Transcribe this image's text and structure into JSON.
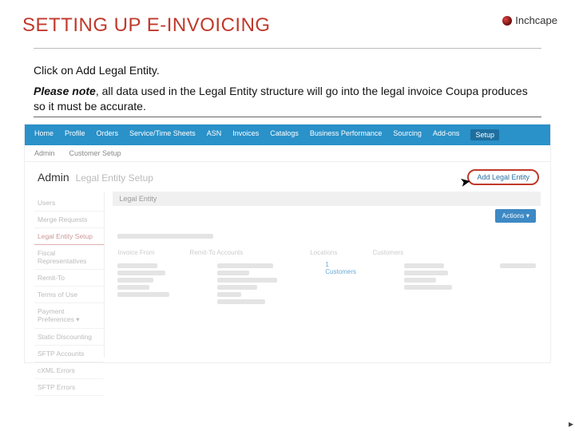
{
  "brand": "Inchcape",
  "title": "SETTING UP E-INVOICING",
  "instruction": "Click on Add Legal Entity.",
  "note": {
    "lead": "Please note",
    "sep": ", ",
    "body": "all data used in the Legal Entity structure will go into the legal invoice Coupa produces so it must be accurate."
  },
  "nav": {
    "items": [
      "Home",
      "Profile",
      "Orders",
      "Service/Time Sheets",
      "ASN",
      "Invoices",
      "Catalogs",
      "Business Performance",
      "Sourcing",
      "Add-ons",
      "Setup"
    ],
    "active_index": 10
  },
  "subnav": {
    "items": [
      "Admin",
      "Customer Setup"
    ]
  },
  "page": {
    "label": "Admin",
    "sublabel": "Legal Entity Setup",
    "add_button": "Add Legal Entity"
  },
  "admin_side": {
    "items": [
      "Users",
      "Merge Requests",
      "Legal Entity Setup",
      "Fiscal Representatives",
      "Remit-To",
      "Terms of Use",
      "Payment Preferences ▾",
      "Static Discounting",
      "SFTP Accounts",
      "cXML Errors",
      "SFTP Errors"
    ],
    "active_index": 2
  },
  "panel": {
    "head": "Legal Entity",
    "actions": "Actions ▾",
    "col_heads": [
      "Invoice From",
      "Remit-To Accounts",
      "Locations",
      "Customers"
    ],
    "customers_link": "1 Customers"
  }
}
